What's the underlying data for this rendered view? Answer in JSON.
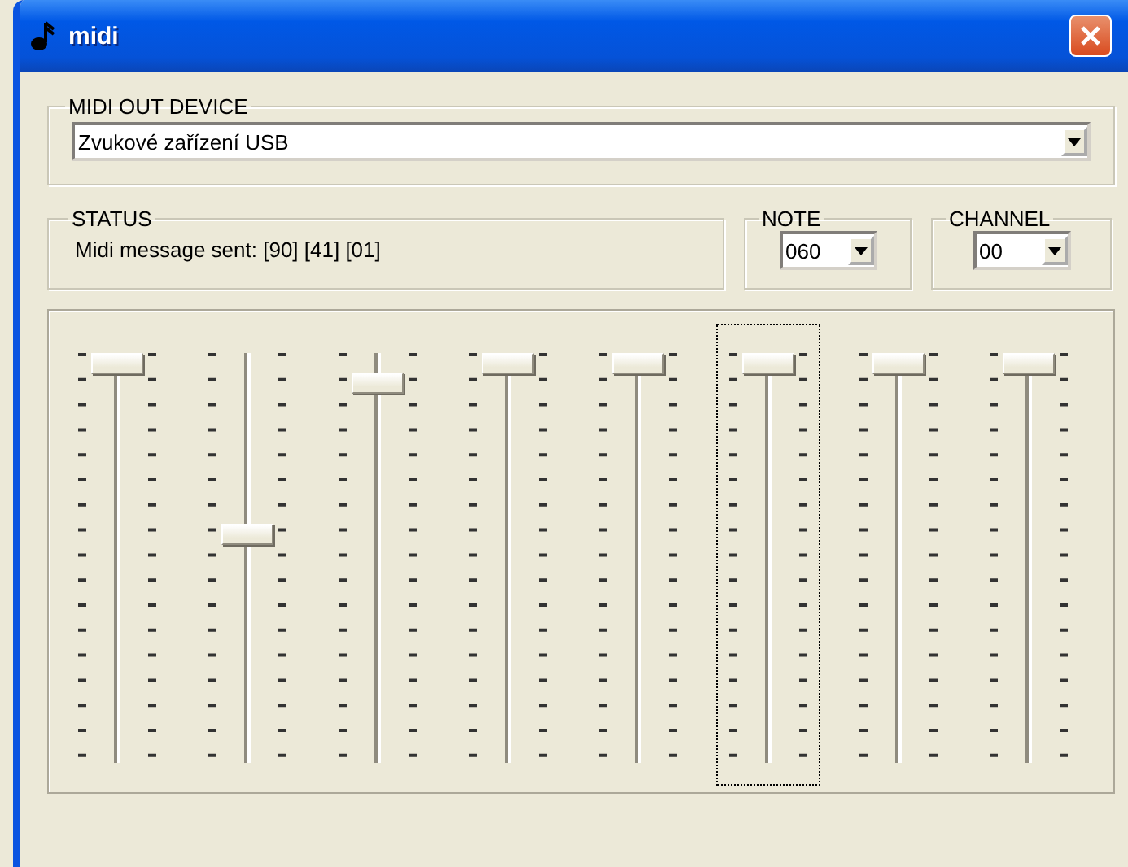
{
  "window": {
    "title": "midi"
  },
  "output_device": {
    "label": "MIDI OUT DEVICE",
    "value": "Zvukové zařízení USB"
  },
  "status": {
    "label": "STATUS",
    "message": "Midi message sent: [90] [41] [01]"
  },
  "note": {
    "label": "NOTE",
    "value": "060"
  },
  "channel": {
    "label": "CHANNEL",
    "value": "00"
  },
  "sliders": [
    {
      "level": 1,
      "focused": false
    },
    {
      "level": 0.56,
      "focused": false
    },
    {
      "level": 0.95,
      "focused": false
    },
    {
      "level": 1,
      "focused": false
    },
    {
      "level": 1,
      "focused": false
    },
    {
      "level": 1,
      "focused": true
    },
    {
      "level": 1,
      "focused": false
    },
    {
      "level": 1,
      "focused": false
    }
  ]
}
